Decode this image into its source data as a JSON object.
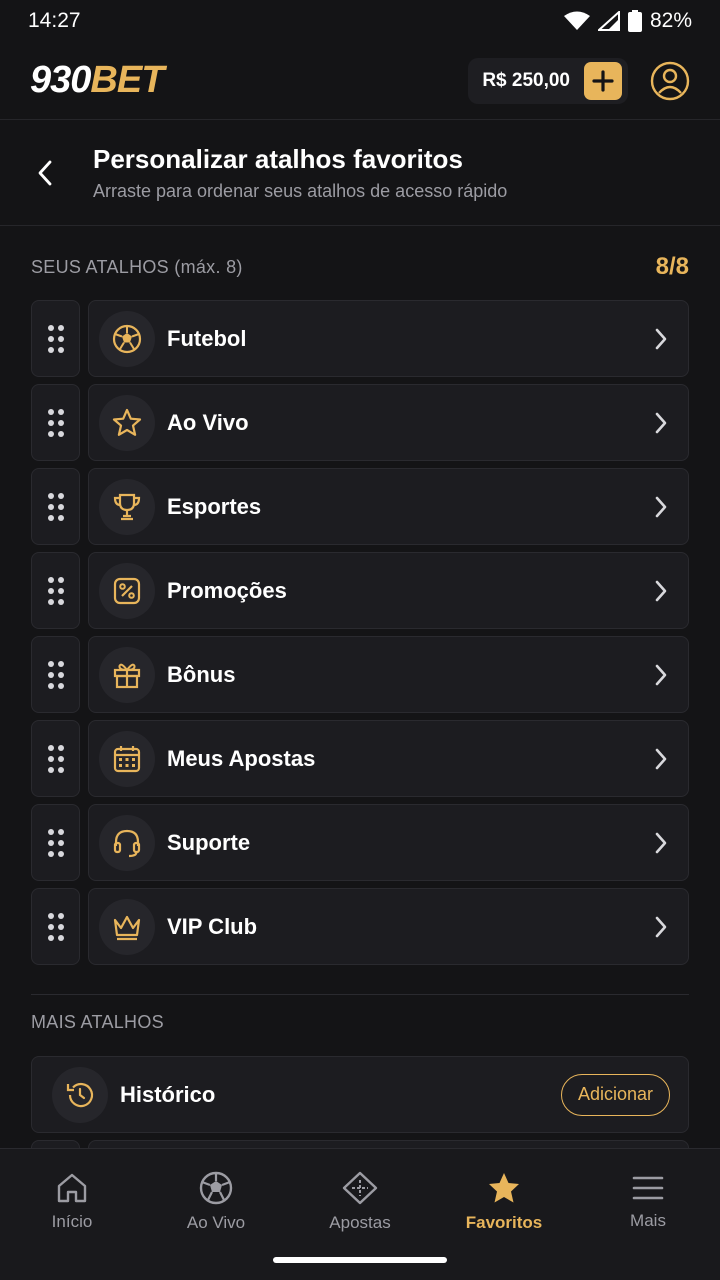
{
  "status_bar": {
    "time": "14:27",
    "battery": "82%"
  },
  "header": {
    "logo_num": "930",
    "logo_bet": "BET",
    "balance": "R$ 250,00"
  },
  "page": {
    "title": "Personalizar atalhos favoritos",
    "subtitle": "Arraste para ordenar seus atalhos de acesso rápido"
  },
  "favorites": {
    "section_label": "SEUS ATALHOS (máx. 8)",
    "counter": "8/8",
    "items": [
      {
        "label": "Futebol",
        "icon": "soccer-ball-icon"
      },
      {
        "label": "Ao Vivo",
        "icon": "star-icon"
      },
      {
        "label": "Esportes",
        "icon": "trophy-icon"
      },
      {
        "label": "Promoções",
        "icon": "percent-icon"
      },
      {
        "label": "Bônus",
        "icon": "gift-icon"
      },
      {
        "label": "Meus Apostas",
        "icon": "calendar-icon"
      },
      {
        "label": "Suporte",
        "icon": "headset-icon"
      },
      {
        "label": "VIP Club",
        "icon": "crown-icon"
      }
    ]
  },
  "more": {
    "section_label": "MAIS ATALHOS",
    "items": [
      {
        "label": "Histórico",
        "icon": "history-icon",
        "action": "Adicionar"
      }
    ]
  },
  "bottom_nav": {
    "items": [
      {
        "label": "Início",
        "icon": "home-icon"
      },
      {
        "label": "Ao Vivo",
        "icon": "soccer-ball-icon"
      },
      {
        "label": "Apostas",
        "icon": "ticket-icon"
      },
      {
        "label": "Favoritos",
        "icon": "star-icon",
        "active": true
      },
      {
        "label": "Mais",
        "icon": "menu-icon"
      }
    ]
  },
  "colors": {
    "accent": "#e8b55b",
    "background": "#141416",
    "card": "#1c1c20",
    "muted": "#9c9ca3"
  }
}
